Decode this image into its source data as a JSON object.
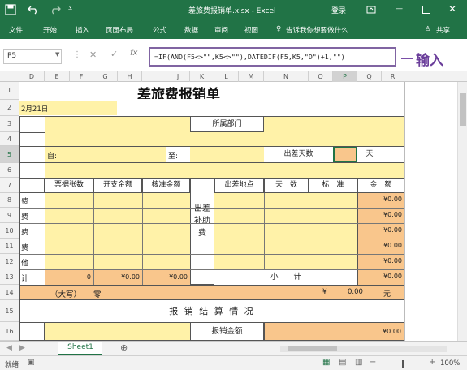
{
  "title_bar": {
    "doc_title": "差旅费报销单.xlsx - Excel",
    "login": "登录"
  },
  "ribbon": {
    "tabs": [
      "文件",
      "开始",
      "插入",
      "页面布局",
      "公式",
      "数据",
      "审阅",
      "视图"
    ],
    "tell_me": "告诉我你想要做什么",
    "share": "共享"
  },
  "formula_bar": {
    "name_box": "P5",
    "formula": "=IF(AND(F5<>\"\",K5<>\"\"),DATEDIF(F5,K5,\"D\")+1,\"\")",
    "annotation": "输入"
  },
  "columns": [
    "D",
    "E",
    "F",
    "G",
    "H",
    "I",
    "J",
    "K",
    "L",
    "M",
    "N",
    "O",
    "P",
    "Q",
    "R"
  ],
  "rows": [
    "1",
    "2",
    "3",
    "4",
    "5",
    "6",
    "7",
    "8",
    "9",
    "10",
    "11",
    "12",
    "13",
    "14",
    "15",
    "16"
  ],
  "sheet": {
    "title": "差旅费报销单",
    "date": "2月21日",
    "dept_label": "所属部门",
    "from_label": "自:",
    "to_label": "至:",
    "days_label": "出差天数",
    "days_unit": "天",
    "h_receipts": "票据张数",
    "h_amount": "开支金额",
    "h_approved": "核准金额",
    "h_subsidy": "出差补助费",
    "h_place": "出差地点",
    "h_days": "天　数",
    "h_standard": "标　准",
    "h_total": "金　额",
    "row_labels": [
      "费",
      "费",
      "费",
      "费",
      "他",
      "计"
    ],
    "amount_zero": "¥0.00",
    "sum_receipts": "0",
    "sum_amount": "¥0.00",
    "sum_approved": "¥0.00",
    "subtotal": "小　　计",
    "capital_label": "（大写）",
    "capital_value": "零",
    "yen": "¥",
    "yen_value": "0.00",
    "yuan": "元",
    "settlement": "报 销 结 算 情 况",
    "reimburse_label": "报销金额"
  },
  "sheet_tab": "Sheet1",
  "status": {
    "ready": "就绪",
    "zoom": "100%"
  }
}
